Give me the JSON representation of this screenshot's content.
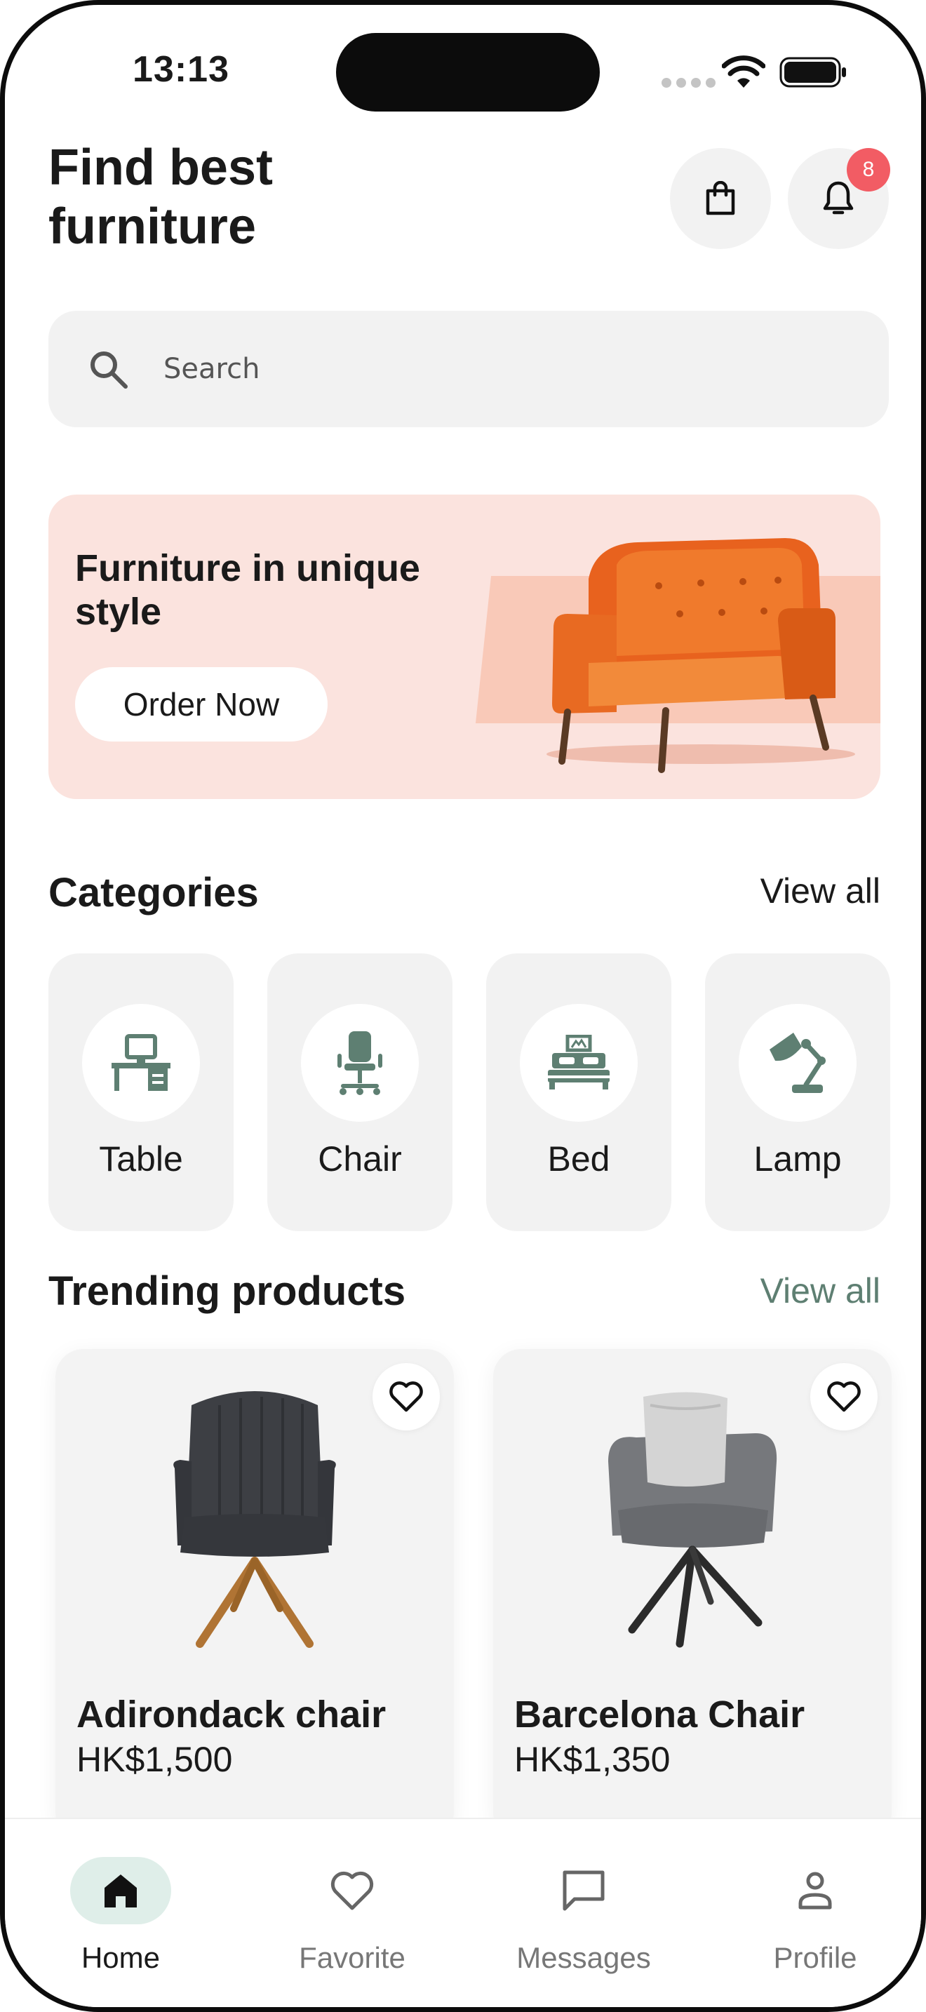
{
  "status_bar": {
    "time": "13:13"
  },
  "header": {
    "title_line1": "Find best",
    "title_line2": "furniture",
    "notification_count": "8"
  },
  "search": {
    "placeholder": "Search"
  },
  "banner": {
    "headline": "Furniture  in unique style",
    "button_label": "Order Now"
  },
  "categories": {
    "title": "Categories",
    "view_all": "View all",
    "items": [
      {
        "label": "Table",
        "icon": "desk-icon"
      },
      {
        "label": "Chair",
        "icon": "office-chair-icon"
      },
      {
        "label": "Bed",
        "icon": "bed-icon"
      },
      {
        "label": "Lamp",
        "icon": "desk-lamp-icon"
      }
    ]
  },
  "trending": {
    "title": "Trending products",
    "view_all": "View all",
    "products": [
      {
        "name": "Adirondack chair",
        "price": "HK$1,500"
      },
      {
        "name": "Barcelona Chair",
        "price": "HK$1,350"
      }
    ]
  },
  "tabbar": {
    "items": [
      {
        "label": "Home",
        "icon": "home-icon",
        "active": true
      },
      {
        "label": "Favorite",
        "icon": "heart-icon",
        "active": false
      },
      {
        "label": "Messages",
        "icon": "message-icon",
        "active": false
      },
      {
        "label": "Profile",
        "icon": "profile-icon",
        "active": false
      }
    ]
  },
  "colors": {
    "accent": "#5e7f72",
    "badge": "#f25c64",
    "banner_bg": "#fbe3de",
    "active_tab_bg": "#dfeee9"
  }
}
